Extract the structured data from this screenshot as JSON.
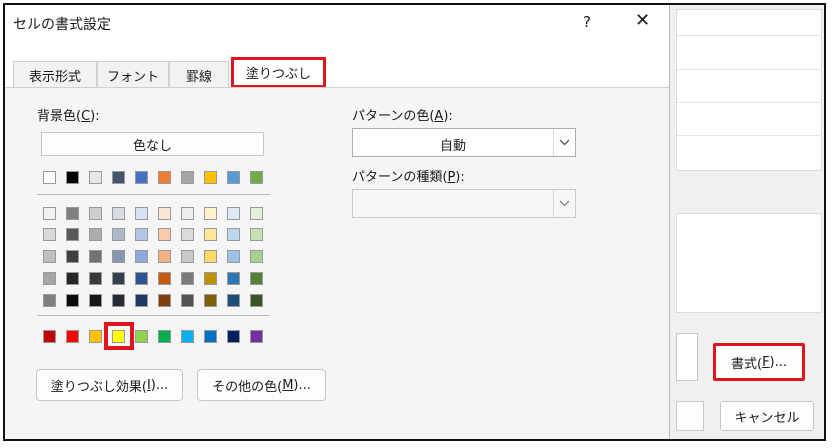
{
  "dialog": {
    "title": "セルの書式設定",
    "help_label": "?",
    "close_label": "✕"
  },
  "tabs": [
    {
      "label": "表示形式"
    },
    {
      "label": "フォント"
    },
    {
      "label": "罫線"
    },
    {
      "label": "塗りつぶし"
    }
  ],
  "background_color": {
    "label": "背景色(",
    "key": "C",
    "label_end": "):",
    "no_color_label": "色なし"
  },
  "palette": {
    "row1": [
      "#ffffff",
      "#000000",
      "#e7e6e6",
      "#44546a",
      "#4472c4",
      "#ed7d31",
      "#a5a5a5",
      "#ffc000",
      "#5b9bd5",
      "#70ad47"
    ],
    "theme_rows": [
      [
        "#f2f2f2",
        "#7f7f7f",
        "#d0cece",
        "#d6dce4",
        "#d9e2f3",
        "#fbe5d5",
        "#ededed",
        "#fff2cc",
        "#deebf6",
        "#e2efd9"
      ],
      [
        "#d8d8d8",
        "#595959",
        "#aeabab",
        "#adb9ca",
        "#b4c6e7",
        "#f7cbac",
        "#dbdbdb",
        "#fee599",
        "#bdd7ee",
        "#c5e0b3"
      ],
      [
        "#bfbfbf",
        "#3f3f3f",
        "#757171",
        "#8496b0",
        "#8eaadb",
        "#f4b183",
        "#c9c9c9",
        "#ffd965",
        "#9cc3e5",
        "#a8d08d"
      ],
      [
        "#a5a5a5",
        "#262626",
        "#3a3838",
        "#323f4f",
        "#2f5496",
        "#c55a11",
        "#7b7b7b",
        "#bf9000",
        "#2e75b5",
        "#538135"
      ],
      [
        "#7f7f7f",
        "#0c0c0c",
        "#171616",
        "#222a35",
        "#1f3864",
        "#833c0b",
        "#525252",
        "#7f6000",
        "#1e4e79",
        "#375623"
      ]
    ],
    "standard": [
      "#c00000",
      "#ff0000",
      "#ffc000",
      "#ffff00",
      "#92d050",
      "#00b050",
      "#00b0f0",
      "#0070c0",
      "#002060",
      "#7030a0"
    ],
    "selected": "#ffff00"
  },
  "pattern_color": {
    "label": "パターンの色(",
    "key": "A",
    "label_end": "):",
    "value": "自動"
  },
  "pattern_type": {
    "label": "パターンの種類(",
    "key": "P",
    "label_end": "):",
    "value": ""
  },
  "buttons": {
    "fill_effects": "塗りつぶし効果(",
    "fill_effects_key": "I",
    "fill_effects_end": ")...",
    "more_colors": "その他の色(",
    "more_colors_key": "M",
    "more_colors_end": ")..."
  },
  "background_window": {
    "format_label": "書式(",
    "format_key": "F",
    "format_end": ")...",
    "cancel_label": "キャンセル"
  },
  "colors": {
    "highlight": "#e0141e"
  }
}
